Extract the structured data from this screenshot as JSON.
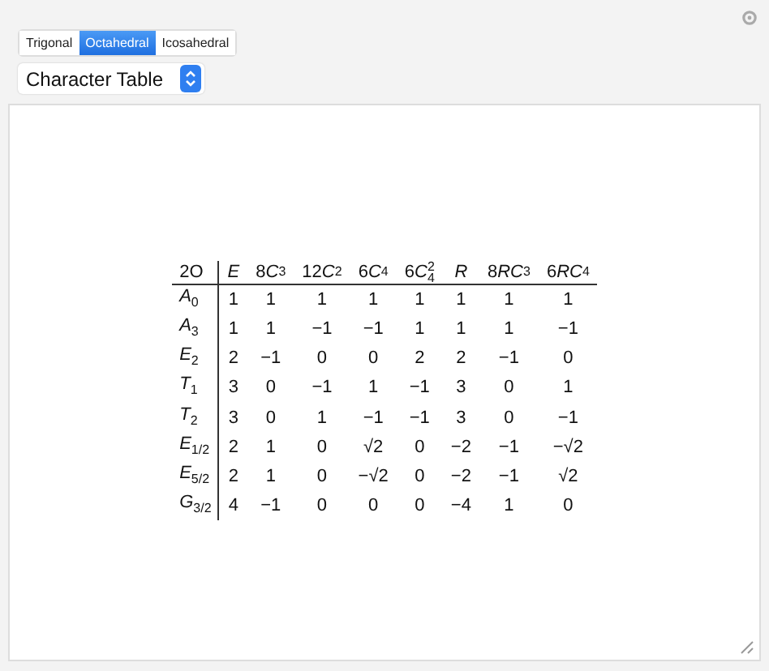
{
  "tabs": [
    {
      "label": "Trigonal",
      "selected": false
    },
    {
      "label": "Octahedral",
      "selected": true
    },
    {
      "label": "Icosahedral",
      "selected": false
    }
  ],
  "dropdown": {
    "value": "Character Table"
  },
  "table": {
    "corner": "2O",
    "columns": [
      {
        "symbol": "E"
      },
      {
        "coef": "8",
        "symbol": "C",
        "sub": "3"
      },
      {
        "coef": "12",
        "symbol": "C",
        "sub": "2"
      },
      {
        "coef": "6",
        "symbol": "C",
        "sub": "4"
      },
      {
        "coef": "6",
        "symbol": "C",
        "sub": "4",
        "sup": "2"
      },
      {
        "symbol": "R"
      },
      {
        "coef": "8",
        "symbol": "RC",
        "sub": "3"
      },
      {
        "coef": "6",
        "symbol": "RC",
        "sub": "4"
      }
    ],
    "rows": [
      {
        "symbol": "A",
        "sub": "0",
        "cells": [
          "1",
          "1",
          "1",
          "1",
          "1",
          "1",
          "1",
          "1"
        ]
      },
      {
        "symbol": "A",
        "sub": "3",
        "cells": [
          "1",
          "1",
          "−1",
          "−1",
          "1",
          "1",
          "1",
          "−1"
        ]
      },
      {
        "symbol": "E",
        "sub": "2",
        "cells": [
          "2",
          "−1",
          "0",
          "0",
          "2",
          "2",
          "−1",
          "0"
        ]
      },
      {
        "symbol": "T",
        "sub": "1",
        "cells": [
          "3",
          "0",
          "−1",
          "1",
          "−1",
          "3",
          "0",
          "1"
        ]
      },
      {
        "symbol": "T",
        "sub": "2",
        "cells": [
          "3",
          "0",
          "1",
          "−1",
          "−1",
          "3",
          "0",
          "−1"
        ]
      },
      {
        "symbol": "E",
        "sub": "1/2",
        "cells": [
          "2",
          "1",
          "0",
          "√2",
          "0",
          "−2",
          "−1",
          "−√2"
        ]
      },
      {
        "symbol": "E",
        "sub": "5/2",
        "cells": [
          "2",
          "1",
          "0",
          "−√2",
          "0",
          "−2",
          "−1",
          "√2"
        ]
      },
      {
        "symbol": "G",
        "sub": "3/2",
        "cells": [
          "4",
          "−1",
          "0",
          "0",
          "0",
          "−4",
          "1",
          "0"
        ]
      }
    ]
  }
}
